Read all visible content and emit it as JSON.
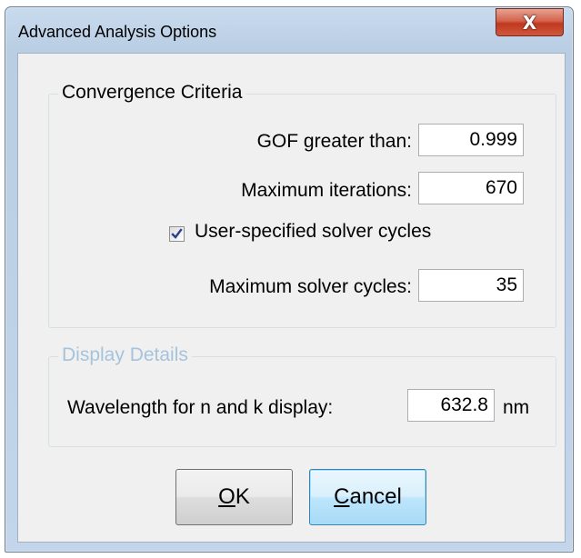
{
  "window": {
    "title": "Advanced Analysis Options",
    "close_glyph": "X"
  },
  "convergence": {
    "legend": "Convergence Criteria",
    "gof_label": "GOF greater than:",
    "gof_value": "0.999",
    "max_iter_label": "Maximum iterations:",
    "max_iter_value": "670",
    "user_solver_label": "User-specified solver cycles",
    "user_solver_checked": true,
    "max_solver_label": "Maximum solver cycles:",
    "max_solver_value": "35"
  },
  "display": {
    "legend": "Display Details",
    "wavelength_label": "Wavelength for n and k display:",
    "wavelength_value": "632.8",
    "wavelength_unit": "nm"
  },
  "buttons": {
    "ok_mnemonic": "O",
    "ok_rest": "K",
    "cancel_mnemonic": "C",
    "cancel_rest": "ancel"
  },
  "colors": {
    "disabled_legend": "#a6c3dd",
    "close_button": "#c0391f",
    "check_mark": "#2b3f8f"
  },
  "icons": {
    "close": "close-icon",
    "check": "checkmark-icon"
  }
}
